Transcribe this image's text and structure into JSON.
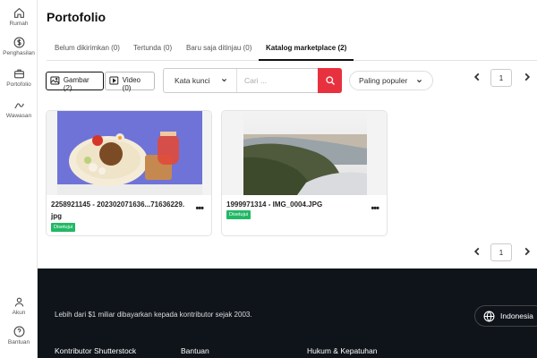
{
  "sidebar": {
    "items": [
      {
        "label": "Rumah",
        "icon": "home-icon"
      },
      {
        "label": "Penghasilan",
        "icon": "dollar-icon"
      },
      {
        "label": "Portofolio",
        "icon": "briefcase-icon"
      },
      {
        "label": "Wawasan",
        "icon": "trend-icon"
      }
    ],
    "bottom": [
      {
        "label": "Akun",
        "icon": "user-icon"
      },
      {
        "label": "Bantuan",
        "icon": "help-icon"
      }
    ]
  },
  "page": {
    "title": "Portofolio"
  },
  "tabs": [
    {
      "label": "Belum dikirimkan (0)",
      "active": false
    },
    {
      "label": "Tertunda (0)",
      "active": false
    },
    {
      "label": "Baru saja ditinjau (0)",
      "active": false
    },
    {
      "label": "Katalog marketplace (2)",
      "active": true
    }
  ],
  "toolbar": {
    "image_label": "Gambar (2)",
    "video_label": "Video (0)",
    "keyword_label": "Kata kunci",
    "search_placeholder": "Cari ...",
    "sort_label": "Paling populer",
    "accent": "#e8313f"
  },
  "pager": {
    "page": "1"
  },
  "cards": [
    {
      "name": "2258921145 - 202302071636...71636229.jpg",
      "status": "Disetujui"
    },
    {
      "name": "1999971314 - IMG_0004.JPG",
      "status": "Disetujui"
    }
  ],
  "footer": {
    "tagline": "Lebih dari $1 miliar dibayarkan kepada kontributor sejak 2003.",
    "language": "Indonesia",
    "columns": [
      "Kontributor Shutterstock",
      "Bantuan",
      "Hukum & Kepatuhan"
    ]
  }
}
